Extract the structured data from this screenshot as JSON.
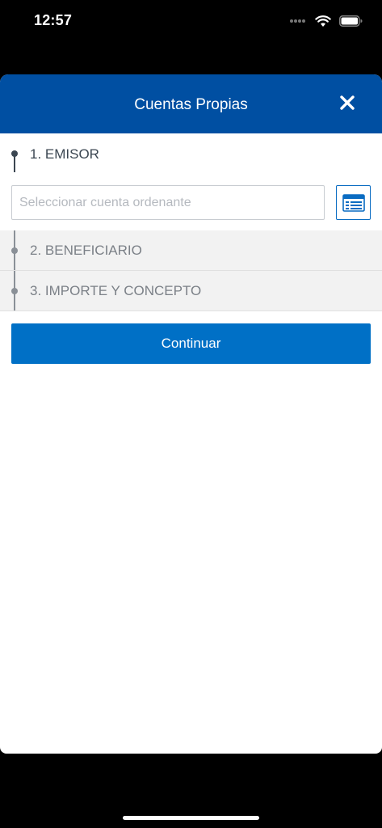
{
  "status_bar": {
    "time": "12:57"
  },
  "header": {
    "title": "Cuentas Propias",
    "close_icon": "close-icon"
  },
  "steps": [
    {
      "label": "1. EMISOR"
    },
    {
      "label": "2. BENEFICIARIO"
    },
    {
      "label": "3. IMPORTE Y CONCEPTO"
    }
  ],
  "emisor": {
    "account_placeholder": "Seleccionar cuenta ordenante",
    "account_value": "",
    "picker_icon": "account-list-icon"
  },
  "actions": {
    "continue_label": "Continuar"
  },
  "colors": {
    "header_bg": "#004fa2",
    "primary_button": "#0070c6",
    "step_active": "#3b4651",
    "step_inactive": "#7b8087"
  }
}
